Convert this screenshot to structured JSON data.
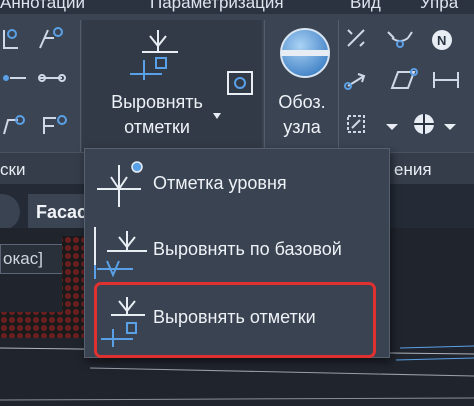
{
  "menubar": {
    "items": [
      "Аннотации",
      "Параметризация",
      "Вид",
      "Упра"
    ]
  },
  "ribbon": {
    "align_button": {
      "line1": "Выровнять",
      "line2": "отметки"
    },
    "node_button": {
      "line1": "Обоз.",
      "line2": "узла"
    },
    "panel_left_label": "ски",
    "panel_right_label": "ения"
  },
  "tabs": {
    "document_tab": "Facac"
  },
  "canvas": {
    "status_text": "окас]"
  },
  "dropdown": {
    "items": [
      {
        "label": "Отметка уровня",
        "icon": "level-mark-icon"
      },
      {
        "label": "Выровнять по базовой",
        "icon": "align-base-icon"
      },
      {
        "label": "Выровнять отметки",
        "icon": "align-marks-icon"
      }
    ],
    "highlighted_index": 2,
    "highlight_color": "#e03131"
  },
  "colors": {
    "accent_blue": "#5aa0e6",
    "ribbon_bg": "#3b4453",
    "canvas_bg": "#20252d"
  }
}
